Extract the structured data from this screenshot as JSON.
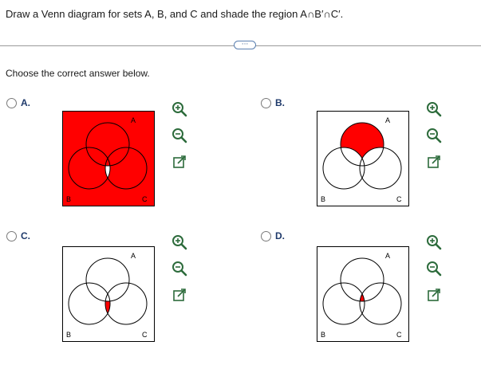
{
  "question": "Draw a Venn diagram for sets A, B, and C and shade the region A∩B′∩C′.",
  "more_button_label": "···",
  "prompt": "Choose the correct answer below.",
  "colors": {
    "shade": "#ff0000",
    "circle_stroke": "#000000",
    "label": "#1f3a6b"
  },
  "set_labels": {
    "a": "A",
    "b": "B",
    "c": "C"
  },
  "tool_icons": [
    "zoom-in-icon",
    "zoom-out-icon",
    "open-in-new-icon"
  ],
  "options": [
    {
      "id": "a",
      "label": "A.",
      "shading": "outside-and-center"
    },
    {
      "id": "b",
      "label": "B.",
      "shading": "a-only"
    },
    {
      "id": "c",
      "label": "C.",
      "shading": "b-and-c-not-a"
    },
    {
      "id": "d",
      "label": "D.",
      "shading": "a-b-c"
    }
  ]
}
